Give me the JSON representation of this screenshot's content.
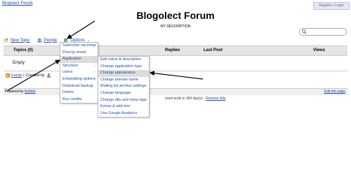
{
  "header": {
    "site_link": "Blogolect Forum",
    "login": "Register / Login",
    "title": "Blogolect Forum",
    "description": "MY DESCRIPTION"
  },
  "toolbar": {
    "new_topic": "New Topic",
    "people": "People",
    "options": "Options"
  },
  "table": {
    "headers": [
      "Topics (0)",
      "Replies",
      "Last Post",
      "Views"
    ],
    "empty": "Empty"
  },
  "feeds": {
    "feeds": "Feeds",
    "created_by": "Created by"
  },
  "footer": {
    "powered_prefix": "Powered by",
    "nabble": "Nabble",
    "edit": "Edit this page"
  },
  "notice": {
    "text": "eriod ends in 360 day(s) -",
    "remove_ads": "Remove Ads"
  },
  "menu_options": [
    {
      "label": "Subscribe via email",
      "sub": false
    },
    {
      "label": "Post by email",
      "sub": false
    },
    {
      "label": "Application",
      "sub": true
    },
    {
      "label": "Structure",
      "sub": true
    },
    {
      "label": "Users",
      "sub": true
    },
    {
      "label": "Embedding options",
      "sub": false
    },
    {
      "label": "Download backup",
      "sub": false
    },
    {
      "label": "Delete",
      "sub": false
    },
    {
      "label": "Buy credits",
      "sub": false
    }
  ],
  "menu_application": [
    {
      "label": "Edit name & description",
      "highlight": false
    },
    {
      "label": "Change application type",
      "highlight": false
    },
    {
      "label": "Change appearance",
      "highlight": true
    },
    {
      "label": "Change domain name",
      "highlight": false
    },
    {
      "label": "Mailing list archive settings",
      "highlight": false
    },
    {
      "label": "Change language",
      "highlight": false
    },
    {
      "label": "Change title and meta tags",
      "highlight": false
    },
    {
      "label": "Extras & add-ons",
      "highlight": false
    },
    {
      "label": "Use Google Analytics",
      "highlight": false
    }
  ]
}
